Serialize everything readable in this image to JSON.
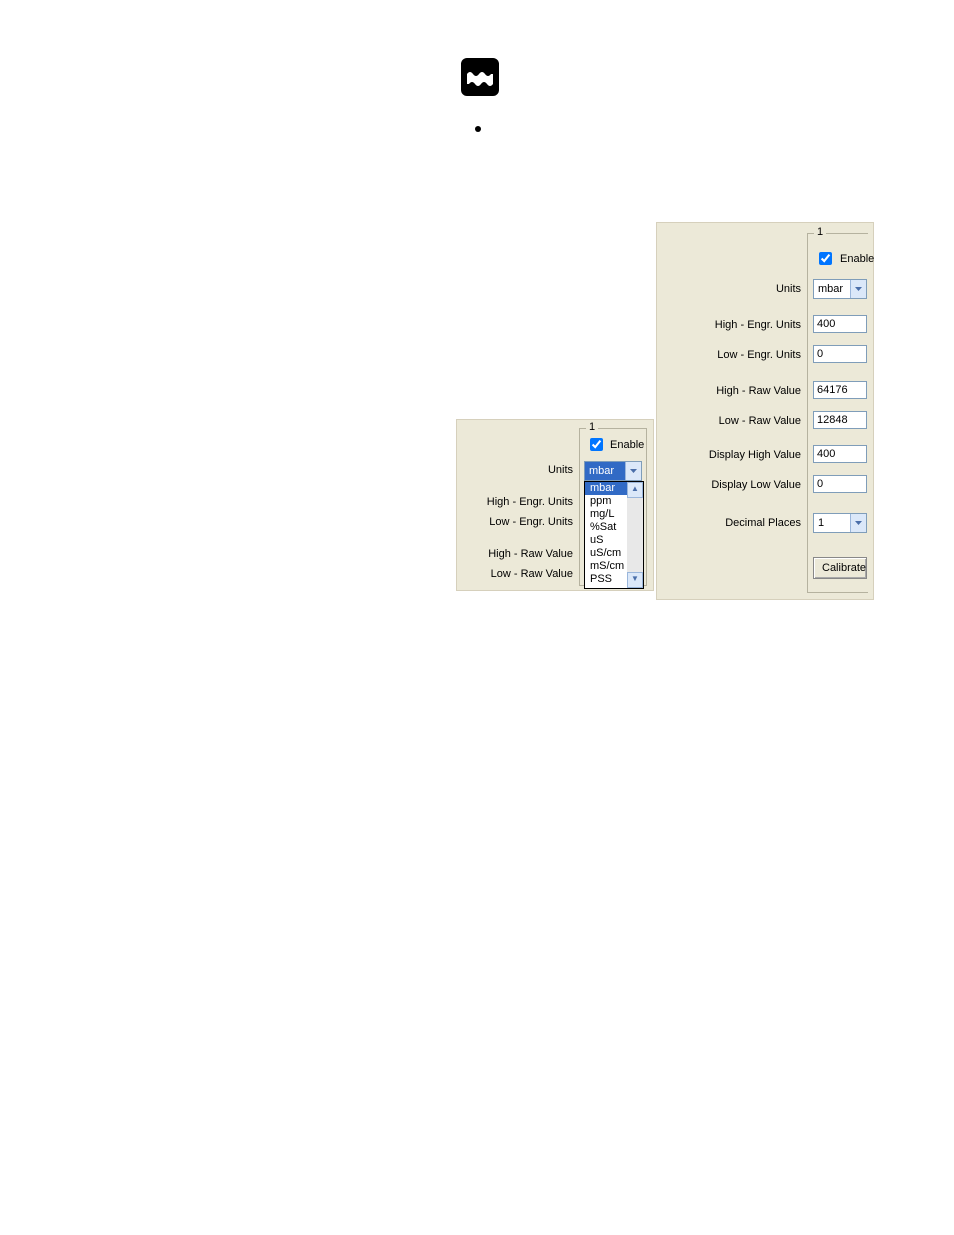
{
  "panelA": {
    "legend": "1",
    "enable_label": "Enable",
    "enable_checked": true,
    "labels": {
      "units": "Units",
      "high_engr": "High - Engr. Units",
      "low_engr": "Low - Engr. Units",
      "high_raw": "High - Raw Value",
      "low_raw": "Low - Raw Value"
    },
    "units_selected": "mbar",
    "units_options": [
      "mbar",
      "ppm",
      "mg/L",
      "%Sat",
      "uS",
      "uS/cm",
      "mS/cm",
      "PSS"
    ]
  },
  "panelB": {
    "legend": "1",
    "enable_label": "Enable",
    "enable_checked": true,
    "labels": {
      "units": "Units",
      "high_engr": "High - Engr. Units",
      "low_engr": "Low - Engr. Units",
      "high_raw": "High - Raw Value",
      "low_raw": "Low - Raw Value",
      "disp_high": "Display High Value",
      "disp_low": "Display Low Value",
      "dec_places": "Decimal Places"
    },
    "values": {
      "units": "mbar",
      "high_engr": "400",
      "low_engr": "0",
      "high_raw": "64176",
      "low_raw": "12848",
      "disp_high": "400",
      "disp_low": "0",
      "dec_places": "1"
    },
    "calibrate_label": "Calibrate"
  }
}
